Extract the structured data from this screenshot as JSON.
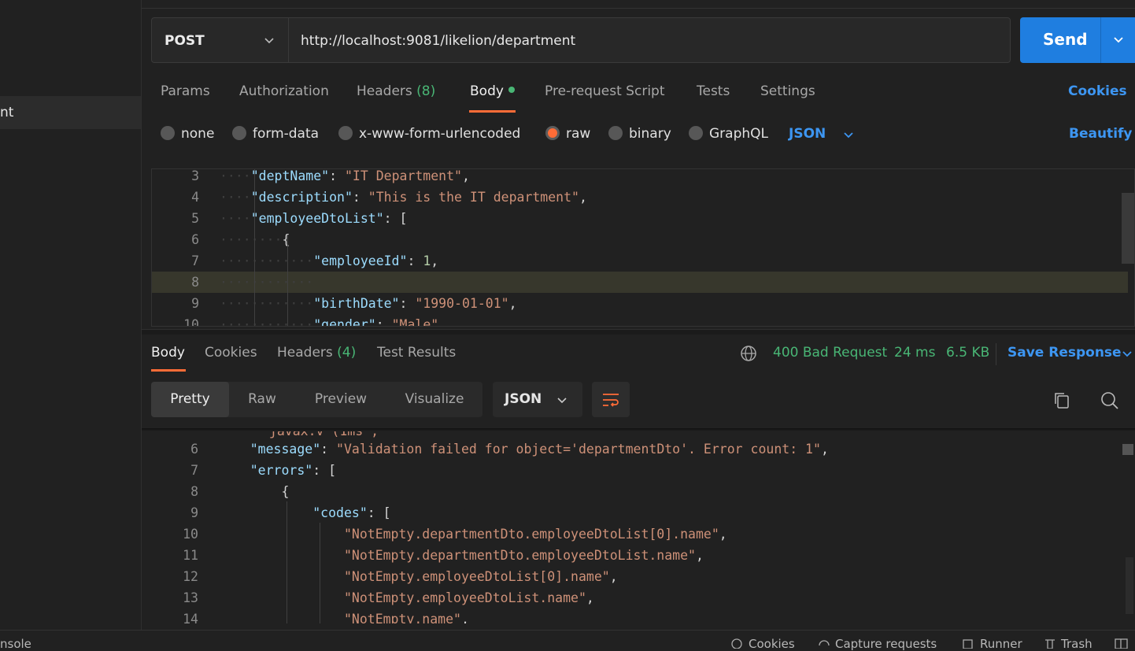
{
  "sidebar": {
    "selected_item_partial": "nt"
  },
  "request": {
    "method": "POST",
    "url": "http://localhost:9081/likelion/department",
    "send_label": "Send",
    "tabs": [
      {
        "label": "Params"
      },
      {
        "label": "Authorization"
      },
      {
        "label": "Headers",
        "count": "(8)"
      },
      {
        "label": "Body"
      },
      {
        "label": "Pre-request Script"
      },
      {
        "label": "Tests"
      },
      {
        "label": "Settings"
      }
    ],
    "cookies_link": "Cookies",
    "body_types": [
      "none",
      "form-data",
      "x-www-form-urlencoded",
      "raw",
      "binary",
      "GraphQL"
    ],
    "selected_body_type": "raw",
    "format": "JSON",
    "beautify": "Beautify",
    "editor_lines": [
      {
        "n": "3",
        "indent": "····",
        "tokens": [
          [
            "k",
            "\"deptName\""
          ],
          [
            "p",
            ": "
          ],
          [
            "s",
            "\"IT Department\""
          ],
          [
            "p",
            ","
          ]
        ]
      },
      {
        "n": "4",
        "indent": "····",
        "tokens": [
          [
            "k",
            "\"description\""
          ],
          [
            "p",
            ": "
          ],
          [
            "s",
            "\"This is the IT department\""
          ],
          [
            "p",
            ","
          ]
        ]
      },
      {
        "n": "5",
        "indent": "····",
        "tokens": [
          [
            "k",
            "\"employeeDtoList\""
          ],
          [
            "p",
            ": ["
          ]
        ]
      },
      {
        "n": "6",
        "indent": "········",
        "tokens": [
          [
            "p",
            "{"
          ]
        ]
      },
      {
        "n": "7",
        "indent": "············",
        "tokens": [
          [
            "k",
            "\"employeeId\""
          ],
          [
            "p",
            ": "
          ],
          [
            "n",
            "1"
          ],
          [
            "p",
            ","
          ]
        ]
      },
      {
        "n": "8",
        "indent": "············",
        "tokens": []
      },
      {
        "n": "9",
        "indent": "············",
        "tokens": [
          [
            "k",
            "\"birthDate\""
          ],
          [
            "p",
            ": "
          ],
          [
            "s",
            "\"1990-01-01\""
          ],
          [
            "p",
            ","
          ]
        ]
      },
      {
        "n": "10",
        "indent": "············",
        "tokens": [
          [
            "k",
            "\"gender\""
          ],
          [
            "p",
            ": "
          ],
          [
            "s",
            "\"Male\""
          ]
        ]
      }
    ],
    "highlighted_line": "8"
  },
  "response": {
    "tabs": [
      {
        "label": "Body"
      },
      {
        "label": "Cookies"
      },
      {
        "label": "Headers",
        "count": "(4)"
      },
      {
        "label": "Test Results"
      }
    ],
    "status": "400 Bad Request",
    "time": "24 ms",
    "size": "6.5 KB",
    "save_response": "Save Response",
    "view_modes": [
      "Pretty",
      "Raw",
      "Preview",
      "Visualize"
    ],
    "selected_view": "Pretty",
    "format": "JSON",
    "partial_top_line": "\"javax.v\"(1ms\",",
    "editor_lines": [
      {
        "n": "6",
        "indent": "    ",
        "tokens": [
          [
            "k",
            "\"message\""
          ],
          [
            "p",
            ": "
          ],
          [
            "s",
            "\"Validation failed for object='departmentDto'. Error count: 1\""
          ],
          [
            "p",
            ","
          ]
        ]
      },
      {
        "n": "7",
        "indent": "    ",
        "tokens": [
          [
            "k",
            "\"errors\""
          ],
          [
            "p",
            ": ["
          ]
        ]
      },
      {
        "n": "8",
        "indent": "        ",
        "tokens": [
          [
            "p",
            "{"
          ]
        ]
      },
      {
        "n": "9",
        "indent": "            ",
        "tokens": [
          [
            "k",
            "\"codes\""
          ],
          [
            "p",
            ": ["
          ]
        ]
      },
      {
        "n": "10",
        "indent": "                ",
        "tokens": [
          [
            "s",
            "\"NotEmpty.departmentDto.employeeDtoList[0].name\""
          ],
          [
            "p",
            ","
          ]
        ]
      },
      {
        "n": "11",
        "indent": "                ",
        "tokens": [
          [
            "s",
            "\"NotEmpty.departmentDto.employeeDtoList.name\""
          ],
          [
            "p",
            ","
          ]
        ]
      },
      {
        "n": "12",
        "indent": "                ",
        "tokens": [
          [
            "s",
            "\"NotEmpty.employeeDtoList[0].name\""
          ],
          [
            "p",
            ","
          ]
        ]
      },
      {
        "n": "13",
        "indent": "                ",
        "tokens": [
          [
            "s",
            "\"NotEmpty.employeeDtoList.name\""
          ],
          [
            "p",
            ","
          ]
        ]
      },
      {
        "n": "14",
        "indent": "                ",
        "tokens": [
          [
            "s",
            "\"NotEmpty.name\""
          ],
          [
            "p",
            ","
          ]
        ]
      }
    ]
  },
  "statusbar": {
    "console": "nsole",
    "cookies": "Cookies",
    "capture": "Capture requests",
    "runner": "Runner",
    "trash": "Trash"
  },
  "colors": {
    "accent": "#ff6c37",
    "primary": "#1f7ee0",
    "link": "#3d96f2",
    "success": "#49b675"
  },
  "icons": [
    "chevron-down-icon",
    "globe-icon",
    "wrap-lines-icon",
    "copy-icon",
    "search-icon",
    "cookie-icon",
    "capture-icon",
    "runner-icon",
    "trash-icon",
    "layout-icon"
  ]
}
